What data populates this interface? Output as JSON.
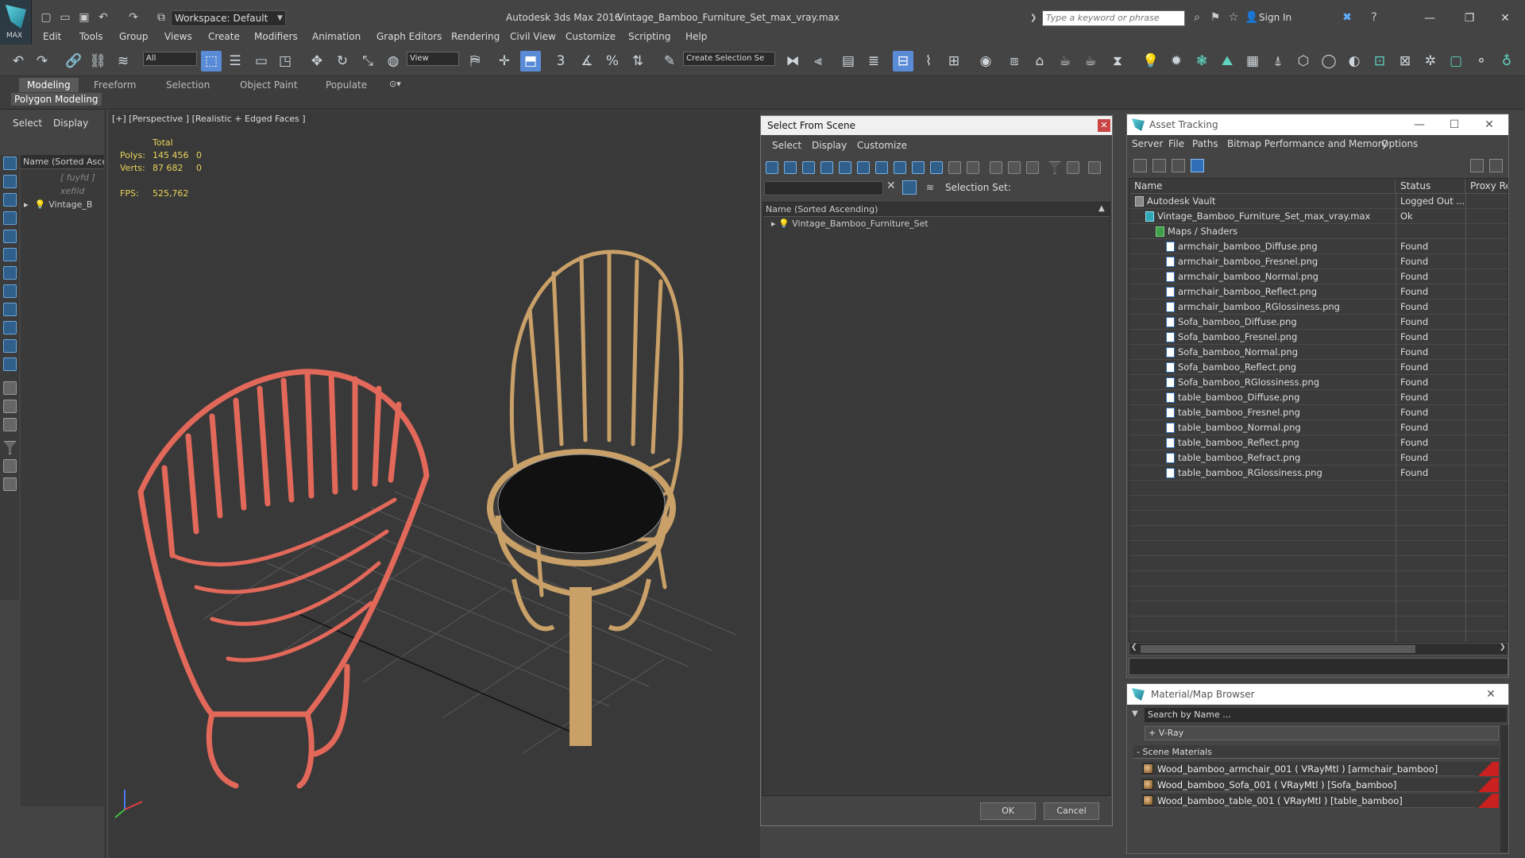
{
  "titlebar": {
    "logo_text": "MAX",
    "workspace": "Workspace: Default",
    "app_title": "Autodesk 3ds Max 2016",
    "doc_title": "Vintage_Bamboo_Furniture_Set_max_vray.max",
    "search_placeholder": "Type a keyword or phrase",
    "signin": "Sign In"
  },
  "menubar": [
    "Edit",
    "Tools",
    "Group",
    "Views",
    "Create",
    "Modifiers",
    "Animation",
    "Graph Editors",
    "Rendering",
    "Civil View",
    "Customize",
    "Scripting",
    "Help"
  ],
  "toolbar": {
    "filter": "All",
    "refcoord": "View",
    "selection_set": "Create Selection Se"
  },
  "ribbon": {
    "tabs": [
      "Modeling",
      "Freeform",
      "Selection",
      "Object Paint",
      "Populate"
    ],
    "sub": "Polygon Modeling"
  },
  "scene_explorer": {
    "tabs": [
      "Select",
      "Display"
    ],
    "header": "Name (Sorted Ascen",
    "rows": [
      "[ fuyfd ]",
      "xefiid",
      "Vintage_B"
    ]
  },
  "viewport": {
    "label": "[+] [Perspective ] [Realistic + Edged Faces ]",
    "stats": {
      "total": "Total",
      "polys_label": "Polys:",
      "polys": "145 456",
      "polys_sel": "0",
      "verts_label": "Verts:",
      "verts": "87 682",
      "verts_sel": "0",
      "fps_label": "FPS:",
      "fps": "525,762"
    }
  },
  "select_from_scene": {
    "title": "Select From Scene",
    "menu": [
      "Select",
      "Display",
      "Customize"
    ],
    "selection_set_label": "Selection Set:",
    "header": "Name (Sorted Ascending)",
    "row": "Vintage_Bamboo_Furniture_Set",
    "ok": "OK",
    "cancel": "Cancel"
  },
  "asset_tracking": {
    "title": "Asset Tracking",
    "menu": [
      "Server",
      "File",
      "Paths",
      "Bitmap Performance and Memory",
      "Options"
    ],
    "columns": [
      "Name",
      "Status",
      "Proxy Re"
    ],
    "rows": [
      {
        "name": "Autodesk Vault",
        "status": "Logged Out ...",
        "indent": 0,
        "kind": "vault"
      },
      {
        "name": "Vintage_Bamboo_Furniture_Set_max_vray.max",
        "status": "Ok",
        "indent": 1,
        "kind": "max"
      },
      {
        "name": "Maps / Shaders",
        "status": "",
        "indent": 2,
        "kind": "folder"
      },
      {
        "name": "armchair_bamboo_Diffuse.png",
        "status": "Found",
        "indent": 3,
        "kind": "file"
      },
      {
        "name": "armchair_bamboo_Fresnel.png",
        "status": "Found",
        "indent": 3,
        "kind": "file"
      },
      {
        "name": "armchair_bamboo_Normal.png",
        "status": "Found",
        "indent": 3,
        "kind": "file"
      },
      {
        "name": "armchair_bamboo_Reflect.png",
        "status": "Found",
        "indent": 3,
        "kind": "file"
      },
      {
        "name": "armchair_bamboo_RGlossiness.png",
        "status": "Found",
        "indent": 3,
        "kind": "file"
      },
      {
        "name": "Sofa_bamboo_Diffuse.png",
        "status": "Found",
        "indent": 3,
        "kind": "file"
      },
      {
        "name": "Sofa_bamboo_Fresnel.png",
        "status": "Found",
        "indent": 3,
        "kind": "file"
      },
      {
        "name": "Sofa_bamboo_Normal.png",
        "status": "Found",
        "indent": 3,
        "kind": "file"
      },
      {
        "name": "Sofa_bamboo_Reflect.png",
        "status": "Found",
        "indent": 3,
        "kind": "file"
      },
      {
        "name": "Sofa_bamboo_RGlossiness.png",
        "status": "Found",
        "indent": 3,
        "kind": "file"
      },
      {
        "name": "table_bamboo_Diffuse.png",
        "status": "Found",
        "indent": 3,
        "kind": "file"
      },
      {
        "name": "table_bamboo_Fresnel.png",
        "status": "Found",
        "indent": 3,
        "kind": "file"
      },
      {
        "name": "table_bamboo_Normal.png",
        "status": "Found",
        "indent": 3,
        "kind": "file"
      },
      {
        "name": "table_bamboo_Reflect.png",
        "status": "Found",
        "indent": 3,
        "kind": "file"
      },
      {
        "name": "table_bamboo_Refract.png",
        "status": "Found",
        "indent": 3,
        "kind": "file"
      },
      {
        "name": "table_bamboo_RGlossiness.png",
        "status": "Found",
        "indent": 3,
        "kind": "file"
      }
    ]
  },
  "material_browser": {
    "title": "Material/Map Browser",
    "search_placeholder": "Search by Name ...",
    "vray": "+ V-Ray",
    "scene_materials": "- Scene Materials",
    "materials": [
      "Wood_bamboo_armchair_001 ( VRayMtl ) [armchair_bamboo]",
      "Wood_bamboo_Sofa_001 ( VRayMtl ) [Sofa_bamboo]",
      "Wood_bamboo_table_001 ( VRayMtl ) [table_bamboo]"
    ]
  },
  "colors": {
    "accent": "#5a8bd6",
    "sofa": "#e2685a",
    "wood": "#c9a068"
  }
}
